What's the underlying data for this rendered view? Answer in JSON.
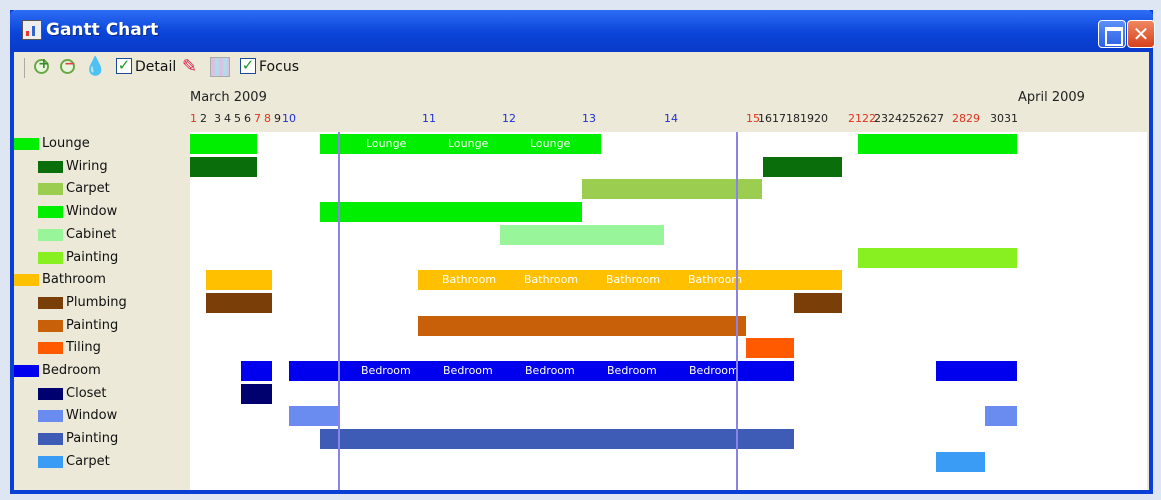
{
  "window": {
    "title": "Gantt Chart",
    "close_glyph": "✕"
  },
  "toolbar": {
    "icons": [
      "zoom-in-icon",
      "zoom-out-icon",
      "drop-icon",
      "eraser-icon",
      "grid-icon"
    ],
    "drop_glyph": "💧",
    "eraser_glyph": "✎",
    "check_glyph": "✓",
    "detail_label": "Detail",
    "detail_checked": true,
    "focus_label": "Focus",
    "focus_checked": true
  },
  "header": {
    "month_left": "March 2009",
    "month_right": "April 2009",
    "days": [
      {
        "t": "1",
        "k": "wk"
      },
      {
        "t": "2",
        "k": ""
      },
      {
        "t": "3",
        "k": ""
      },
      {
        "t": "4",
        "k": ""
      },
      {
        "t": "5",
        "k": ""
      },
      {
        "t": "6",
        "k": ""
      },
      {
        "t": "7",
        "k": "wk"
      },
      {
        "t": "8",
        "k": "wk"
      },
      {
        "t": "9",
        "k": ""
      },
      {
        "t": "10",
        "k": "mj"
      },
      {
        "t": "11",
        "k": "mj"
      },
      {
        "t": "12",
        "k": "mj"
      },
      {
        "t": "13",
        "k": "mj"
      },
      {
        "t": "14",
        "k": "mj"
      },
      {
        "t": "15",
        "k": "wk"
      },
      {
        "t": "1617181920",
        "k": ""
      },
      {
        "t": "2122",
        "k": "wk"
      },
      {
        "t": "2324252627",
        "k": ""
      },
      {
        "t": "2829",
        "k": "wk"
      },
      {
        "t": "3031",
        "k": ""
      }
    ]
  },
  "legend": [
    {
      "label": "Lounge",
      "color": "#00ee00",
      "level": 0
    },
    {
      "label": "Wiring",
      "color": "#0a6e0a",
      "level": 1
    },
    {
      "label": "Carpet",
      "color": "#9acd50",
      "level": 1
    },
    {
      "label": "Window",
      "color": "#00ee00",
      "level": 1
    },
    {
      "label": "Cabinet",
      "color": "#99f599",
      "level": 1
    },
    {
      "label": "Painting",
      "color": "#88f020",
      "level": 1
    },
    {
      "label": "Bathroom",
      "color": "#ffc000",
      "level": 0
    },
    {
      "label": "Plumbing",
      "color": "#7a3e08",
      "level": 1
    },
    {
      "label": "Painting",
      "color": "#c8600a",
      "level": 1
    },
    {
      "label": "Tiling",
      "color": "#ff5a00",
      "level": 1
    },
    {
      "label": "Bedroom",
      "color": "#0000ee",
      "level": 0
    },
    {
      "label": "Closet",
      "color": "#00006e",
      "level": 1
    },
    {
      "label": "Window",
      "color": "#6a8cf0",
      "level": 1
    },
    {
      "label": "Painting",
      "color": "#3e5cb5",
      "level": 1
    },
    {
      "label": "Carpet",
      "color": "#3a9cf5",
      "level": 1
    }
  ],
  "bars": [
    {
      "row": 0,
      "segments": [
        [
          0,
          67
        ],
        [
          130,
          411
        ],
        [
          668,
          827
        ]
      ],
      "color": "#00ee00",
      "labels": [
        "Lounge",
        "Lounge",
        "Lounge",
        "Lounge",
        "Lounge"
      ]
    },
    {
      "row": 1,
      "segments": [
        [
          0,
          67
        ],
        [
          573,
          652
        ]
      ],
      "color": "#0a6e0a"
    },
    {
      "row": 2,
      "segments": [
        [
          392,
          572
        ]
      ],
      "color": "#9acd50"
    },
    {
      "row": 3,
      "segments": [
        [
          130,
          392
        ]
      ],
      "color": "#00ee00"
    },
    {
      "row": 4,
      "segments": [
        [
          310,
          474
        ]
      ],
      "color": "#99f599"
    },
    {
      "row": 5,
      "segments": [
        [
          668,
          827
        ]
      ],
      "color": "#88f020"
    },
    {
      "row": 6,
      "segments": [
        [
          16,
          82
        ],
        [
          228,
          652
        ]
      ],
      "color": "#ffc000",
      "labels": [
        "Bathroom",
        "Bathroom",
        "Bathroom",
        "Bathroom"
      ]
    },
    {
      "row": 7,
      "segments": [
        [
          16,
          82
        ],
        [
          604,
          652
        ]
      ],
      "color": "#7a3e08"
    },
    {
      "row": 8,
      "segments": [
        [
          228,
          556
        ]
      ],
      "color": "#c8600a"
    },
    {
      "row": 9,
      "segments": [
        [
          556,
          604
        ]
      ],
      "color": "#ff5a00"
    },
    {
      "row": 10,
      "segments": [
        [
          51,
          82
        ],
        [
          99,
          604
        ],
        [
          746,
          827
        ]
      ],
      "color": "#0000ee",
      "labels": [
        "Bedroom",
        "Bedroom",
        "Bedroom",
        "Bedroom",
        "Bedroom"
      ]
    },
    {
      "row": 11,
      "segments": [
        [
          51,
          82
        ]
      ],
      "color": "#00006e"
    },
    {
      "row": 12,
      "segments": [
        [
          99,
          148
        ],
        [
          795,
          827
        ]
      ],
      "color": "#6a8cf0"
    },
    {
      "row": 13,
      "segments": [
        [
          130,
          604
        ]
      ],
      "color": "#3e5cb5"
    },
    {
      "row": 14,
      "segments": [
        [
          746,
          795
        ]
      ],
      "color": "#3a9cf5"
    }
  ],
  "focus_lines": [
    148,
    546
  ]
}
